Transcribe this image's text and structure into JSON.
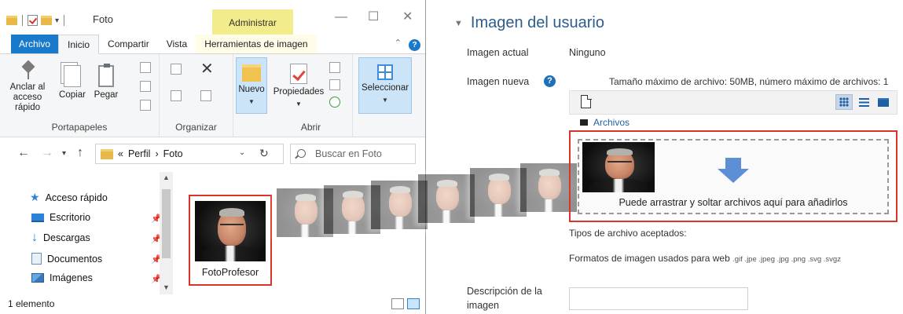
{
  "explorer": {
    "title": "Foto",
    "context_tab": "Administrar",
    "tabs": [
      "Archivo",
      "Inicio",
      "Compartir",
      "Vista",
      "Herramientas de imagen"
    ],
    "ribbon": {
      "anclar": "Anclar al acceso rápido",
      "copiar": "Copiar",
      "pegar": "Pegar",
      "portapapeles": "Portapapeles",
      "organizar": "Organizar",
      "nuevo": "Nuevo",
      "propiedades": "Propiedades",
      "abrir": "Abrir",
      "seleccionar": "Seleccionar"
    },
    "address": {
      "prefix": "«",
      "crumb1": "Perfil",
      "sep": "›",
      "crumb2": "Foto"
    },
    "search_placeholder": "Buscar en Foto",
    "nav_items": [
      {
        "label": "Acceso rápido",
        "icon": "star-icon"
      },
      {
        "label": "Escritorio",
        "icon": "desktop-icon"
      },
      {
        "label": "Descargas",
        "icon": "download-icon"
      },
      {
        "label": "Documentos",
        "icon": "documents-icon"
      },
      {
        "label": "Imágenes",
        "icon": "pictures-icon"
      }
    ],
    "file_name": "FotoProfesor",
    "status": "1 elemento"
  },
  "moodle": {
    "section_title": "Imagen del usuario",
    "current_image_label": "Imagen actual",
    "current_image_value": "Ninguno",
    "new_image_label": "Imagen nueva",
    "max_size": "Tamaño máximo de archivo: 50MB, número máximo de archivos: 1",
    "breadcrumb": "Archivos",
    "drop_text": "Puede arrastrar y soltar archivos aquí para añadirlos",
    "accepted_label": "Tipos de archivo aceptados:",
    "formats_label": "Formatos de imagen usados para web",
    "formats_ext": ".gif .jpe .jpeg .jpg .png .svg .svgz",
    "description_label": "Descripción de la imagen"
  },
  "colors": {
    "highlight_border": "#d9342b",
    "accent": "#1979ca",
    "moodle_title": "#2b5d8e"
  }
}
